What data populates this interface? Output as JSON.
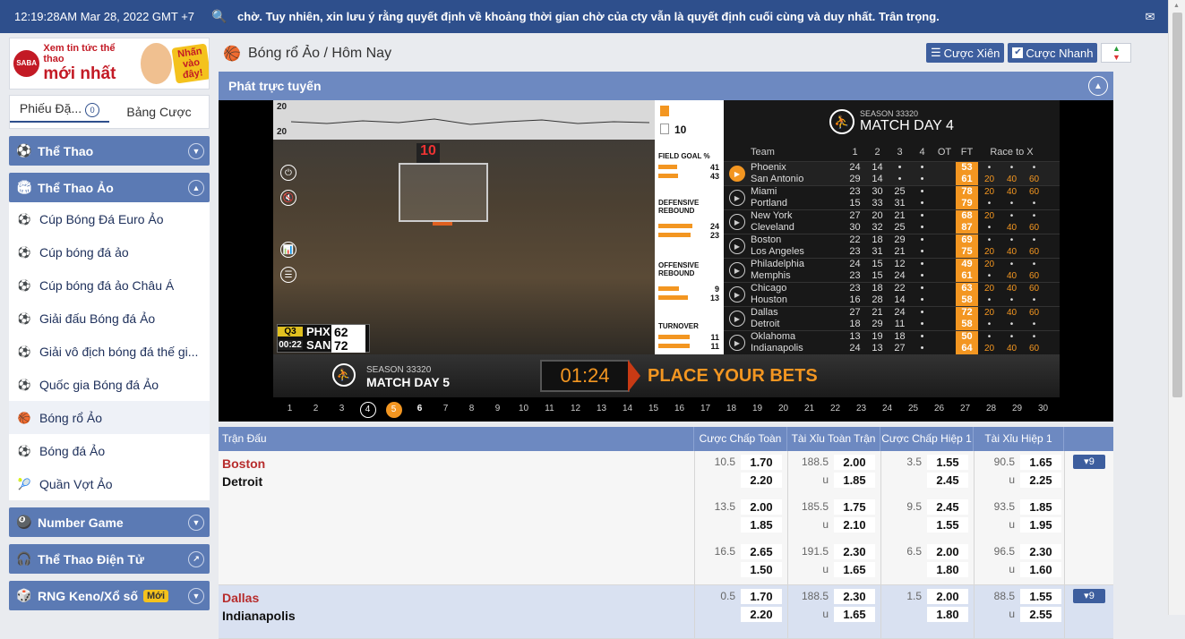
{
  "topbar": {
    "time": "12:19:28AM Mar 28, 2022 GMT +7",
    "marquee": "chờ. Tuy nhiên, xin lưu ý rằng quyết định về khoảng thời gian chờ của cty vẫn là quyết định cuối cùng và duy nhất. Trân trọng.",
    "search_icon": "🔍",
    "mail_icon": "✉"
  },
  "banner": {
    "logo": "SABA",
    "line1": "Xem tin tức thể thao",
    "line2": "mới nhất",
    "promo": "Nhấn vào đây!"
  },
  "tabs": {
    "slip": "Phiếu Đặ...",
    "slip_badge": "0",
    "bets": "Bảng Cược"
  },
  "sidebar": {
    "categories": [
      {
        "label": "Thể Thao",
        "icon": "⚽",
        "chev": "▼"
      },
      {
        "label": "Thể Thao Ảo",
        "icon": "🏟",
        "chev": "▲"
      }
    ],
    "virtual_items": [
      {
        "label": "Cúp Bóng Đá Euro Ảo",
        "icon": "⚽"
      },
      {
        "label": "Cúp bóng đá ảo",
        "icon": "⚽"
      },
      {
        "label": "Cúp bóng đá ảo Châu Á",
        "icon": "⚽"
      },
      {
        "label": "Giải đấu Bóng đá Ảo",
        "icon": "⚽"
      },
      {
        "label": "Giải vô địch bóng đá thế gi...",
        "icon": "⚽"
      },
      {
        "label": "Quốc gia Bóng đá Ảo",
        "icon": "⚽"
      },
      {
        "label": "Bóng rổ Ảo",
        "icon": "🏀"
      },
      {
        "label": "Bóng đá Ảo",
        "icon": "⚽"
      },
      {
        "label": "Quần Vợt Ảo",
        "icon": "🎾"
      }
    ],
    "bottom_categories": [
      {
        "label": "Number Game",
        "icon": "🎱",
        "chev": "▼"
      },
      {
        "label": "Thể Thao Điện Tử",
        "icon": "🎧",
        "chev": "↗"
      },
      {
        "label": "RNG Keno/Xổ số",
        "icon": "🎲",
        "chev": "▼",
        "badge": "Mới"
      }
    ]
  },
  "breadcrumb": "Bóng rổ Ảo / Hôm Nay",
  "tools": {
    "parlay": "Cược Xiên",
    "quick": "Cược Nhanh",
    "parlay_icon": "☰",
    "quick_icon": "✔",
    "sort_up": "▲",
    "sort_down": "▼"
  },
  "live": {
    "title": "Phát trực tuyến",
    "chev": "▲"
  },
  "video": {
    "graph_top": "20",
    "graph_bottom": "20",
    "shot_clock": "10",
    "scorebug": {
      "quarter": "Q3",
      "clock": "00:22",
      "team1": "PHX",
      "score1": "62",
      "team2": "SAN",
      "score2": "72"
    },
    "controls": [
      "⏻",
      "🔇",
      "📊",
      "☰"
    ]
  },
  "stats": {
    "foul_top": "10",
    "groups": [
      {
        "label": "FIELD GOAL %",
        "a": "41",
        "b": "43",
        "fa": 0.41,
        "fb": 0.43
      },
      {
        "label": "DEFENSIVE REBOUND",
        "a": "24",
        "b": "23",
        "fa": 0.75,
        "fb": 0.72
      },
      {
        "label": "OFFENSIVE REBOUND",
        "a": "9",
        "b": "13",
        "fa": 0.45,
        "fb": 0.65
      },
      {
        "label": "TURNOVER",
        "a": "11",
        "b": "11",
        "fa": 0.7,
        "fb": 0.7
      }
    ]
  },
  "results": {
    "season": "SEASON 33320",
    "matchday": "MATCH DAY 4",
    "headers": {
      "team": "Team",
      "q1": "1",
      "q2": "2",
      "q3": "3",
      "q4": "4",
      "ot": "OT",
      "ft": "FT",
      "race": "Race to X"
    },
    "rows": [
      {
        "t1": "Phoenix",
        "t2": "San Antonio",
        "q1a": "24",
        "q1b": "29",
        "q2a": "14",
        "q2b": "14",
        "q3a": "•",
        "q3b": "•",
        "q4a": "•",
        "q4b": "•",
        "ota": "",
        "otb": "",
        "fta": "53",
        "ftb": "61",
        "ra": [
          "•",
          "•",
          "•"
        ],
        "rb": [
          "20",
          "40",
          "60"
        ]
      },
      {
        "t1": "Miami",
        "t2": "Portland",
        "q1a": "23",
        "q1b": "15",
        "q2a": "30",
        "q2b": "33",
        "q3a": "25",
        "q3b": "31",
        "q4a": "•",
        "q4b": "•",
        "ota": "",
        "otb": "",
        "fta": "78",
        "ftb": "79",
        "ra": [
          "20",
          "40",
          "60"
        ],
        "rb": [
          "•",
          "•",
          "•"
        ]
      },
      {
        "t1": "New York",
        "t2": "Cleveland",
        "q1a": "27",
        "q1b": "30",
        "q2a": "20",
        "q2b": "32",
        "q3a": "21",
        "q3b": "25",
        "q4a": "•",
        "q4b": "•",
        "ota": "",
        "otb": "",
        "fta": "68",
        "ftb": "87",
        "ra": [
          "20",
          "•",
          "•"
        ],
        "rb": [
          "•",
          "40",
          "60"
        ]
      },
      {
        "t1": "Boston",
        "t2": "Los Angeles",
        "q1a": "22",
        "q1b": "23",
        "q2a": "18",
        "q2b": "31",
        "q3a": "29",
        "q3b": "21",
        "q4a": "•",
        "q4b": "•",
        "ota": "",
        "otb": "",
        "fta": "69",
        "ftb": "75",
        "ra": [
          "•",
          "•",
          "•"
        ],
        "rb": [
          "20",
          "40",
          "60"
        ]
      },
      {
        "t1": "Philadelphia",
        "t2": "Memphis",
        "q1a": "24",
        "q1b": "23",
        "q2a": "15",
        "q2b": "15",
        "q3a": "12",
        "q3b": "24",
        "q4a": "•",
        "q4b": "•",
        "ota": "",
        "otb": "",
        "fta": "49",
        "ftb": "61",
        "ra": [
          "20",
          "•",
          "•"
        ],
        "rb": [
          "•",
          "40",
          "60"
        ]
      },
      {
        "t1": "Chicago",
        "t2": "Houston",
        "q1a": "23",
        "q1b": "16",
        "q2a": "18",
        "q2b": "28",
        "q3a": "22",
        "q3b": "14",
        "q4a": "•",
        "q4b": "•",
        "ota": "",
        "otb": "",
        "fta": "63",
        "ftb": "58",
        "ra": [
          "20",
          "40",
          "60"
        ],
        "rb": [
          "•",
          "•",
          "•"
        ]
      },
      {
        "t1": "Dallas",
        "t2": "Detroit",
        "q1a": "27",
        "q1b": "18",
        "q2a": "21",
        "q2b": "29",
        "q3a": "24",
        "q3b": "11",
        "q4a": "•",
        "q4b": "•",
        "ota": "",
        "otb": "",
        "fta": "72",
        "ftb": "58",
        "ra": [
          "20",
          "40",
          "60"
        ],
        "rb": [
          "•",
          "•",
          "•"
        ]
      },
      {
        "t1": "Oklahoma",
        "t2": "Indianapolis",
        "q1a": "13",
        "q1b": "24",
        "q2a": "19",
        "q2b": "13",
        "q3a": "18",
        "q3b": "27",
        "q4a": "•",
        "q4b": "•",
        "ota": "",
        "otb": "",
        "fta": "50",
        "ftb": "64",
        "ra": [
          "•",
          "•",
          "•"
        ],
        "rb": [
          "20",
          "40",
          "60"
        ]
      }
    ]
  },
  "bottom": {
    "season": "SEASON 33320",
    "matchday": "MATCH DAY 5",
    "countdown": "01:24",
    "cta": "PLACE YOUR BETS"
  },
  "days": [
    "1",
    "2",
    "3",
    "4",
    "5",
    "6",
    "7",
    "8",
    "9",
    "10",
    "11",
    "12",
    "13",
    "14",
    "15",
    "16",
    "17",
    "18",
    "19",
    "20",
    "21",
    "22",
    "23",
    "24",
    "25",
    "26",
    "27",
    "28",
    "29",
    "30"
  ],
  "odds": {
    "headers": [
      "Trận Đấu",
      "Cược Chấp Toàn ...",
      "Tài Xỉu Toàn Trận",
      "Cược Chấp Hiệp 1",
      "Tài Xỉu Hiệp 1"
    ],
    "matches": [
      {
        "home": "Boston",
        "away": "Detroit",
        "more": "▾9",
        "lines": [
          {
            "hcp": "10.5",
            "hcp1": "1.70",
            "hcp2": "2.20",
            "ou": "188.5",
            "ou1": "2.00",
            "u": "u",
            "ou2": "1.85",
            "h1": "3.5",
            "h11": "1.55",
            "h12": "2.45",
            "ouh": "90.5",
            "ouh1": "1.65",
            "uh": "u",
            "ouh2": "2.25"
          },
          {
            "hcp": "13.5",
            "hcp1": "2.00",
            "hcp2": "1.85",
            "ou": "185.5",
            "ou1": "1.75",
            "u": "u",
            "ou2": "2.10",
            "h1": "9.5",
            "h11": "2.45",
            "h12": "1.55",
            "ouh": "93.5",
            "ouh1": "1.85",
            "uh": "u",
            "ouh2": "1.95"
          },
          {
            "hcp": "16.5",
            "hcp1": "2.65",
            "hcp2": "1.50",
            "ou": "191.5",
            "ou1": "2.30",
            "u": "u",
            "ou2": "1.65",
            "h1": "6.5",
            "h11": "2.00",
            "h12": "1.80",
            "ouh": "96.5",
            "ouh1": "2.30",
            "uh": "u",
            "ouh2": "1.60"
          }
        ]
      },
      {
        "home": "Dallas",
        "away": "Indianapolis",
        "more": "▾9",
        "lines": [
          {
            "hcp": "0.5",
            "hcp1": "1.70",
            "hcp2": "2.20",
            "ou": "188.5",
            "ou1": "2.30",
            "u": "u",
            "ou2": "1.65",
            "h1": "1.5",
            "h11": "2.00",
            "h12": "1.80",
            "ouh": "88.5",
            "ouh1": "1.55",
            "uh": "u",
            "ouh2": "2.55"
          }
        ]
      }
    ]
  }
}
